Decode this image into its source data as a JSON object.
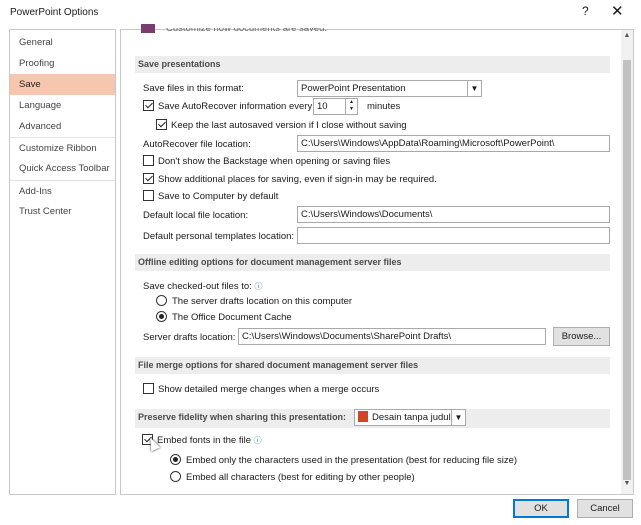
{
  "window": {
    "title": "PowerPoint Options",
    "help": "?",
    "close": "✕"
  },
  "sidebar": {
    "items": [
      {
        "label": "General"
      },
      {
        "label": "Proofing"
      },
      {
        "label": "Save"
      },
      {
        "label": "Language"
      },
      {
        "label": "Advanced"
      },
      {
        "label": "Customize Ribbon"
      },
      {
        "label": "Quick Access Toolbar"
      },
      {
        "label": "Add-Ins"
      },
      {
        "label": "Trust Center"
      }
    ],
    "active": "Save"
  },
  "top_partial_text": "Customize how documents are saved.",
  "save_presentations": {
    "header": "Save presentations",
    "format_label": "Save files in this format:",
    "format_value": "PowerPoint Presentation",
    "autorecover_label": "Save AutoRecover information every",
    "autorecover_checked": true,
    "autorecover_minutes": "10",
    "minutes_label": "minutes",
    "keep_last_label": "Keep the last autosaved version if I close without saving",
    "keep_last_checked": true,
    "autorecover_location_label": "AutoRecover file location:",
    "autorecover_location_value": "C:\\Users\\Windows\\AppData\\Roaming\\Microsoft\\PowerPoint\\",
    "backstage_label": "Don't show the Backstage when opening or saving files",
    "backstage_checked": false,
    "additional_places_label": "Show additional places for saving, even if sign-in may be required.",
    "additional_places_checked": true,
    "save_to_computer_label": "Save to Computer by default",
    "save_to_computer_checked": false,
    "default_local_label": "Default local file location:",
    "default_local_value": "C:\\Users\\Windows\\Documents\\",
    "default_templates_label": "Default personal templates location:",
    "default_templates_value": ""
  },
  "offline": {
    "header": "Offline editing options for document management server files",
    "save_checked_out_label": "Save checked-out files to:",
    "server_drafts_option": "The server drafts location on this computer",
    "office_cache_option": "The Office Document Cache",
    "selected": "The Office Document Cache",
    "server_drafts_label": "Server drafts location:",
    "server_drafts_value": "C:\\Users\\Windows\\Documents\\SharePoint Drafts\\",
    "browse_label": "Browse..."
  },
  "file_merge": {
    "header": "File merge options for shared document management server files",
    "show_merge_label": "Show detailed merge changes when a merge occurs",
    "show_merge_checked": false
  },
  "fidelity": {
    "header": "Preserve fidelity when sharing this presentation:",
    "presentation_value": "Desain tanpa judul",
    "embed_fonts_label": "Embed fonts in the file",
    "embed_fonts_checked": true,
    "embed_only_label": "Embed only the characters used in the presentation (best for reducing file size)",
    "embed_all_label": "Embed all characters (best for editing by other people)",
    "selected": "Embed only the characters used in the presentation (best for reducing file size)"
  },
  "footer": {
    "ok_label": "OK",
    "cancel_label": "Cancel"
  },
  "colors": {
    "active_nav": "#f6c6ae",
    "section_bg": "#ededed",
    "accent": "#0078d7"
  }
}
